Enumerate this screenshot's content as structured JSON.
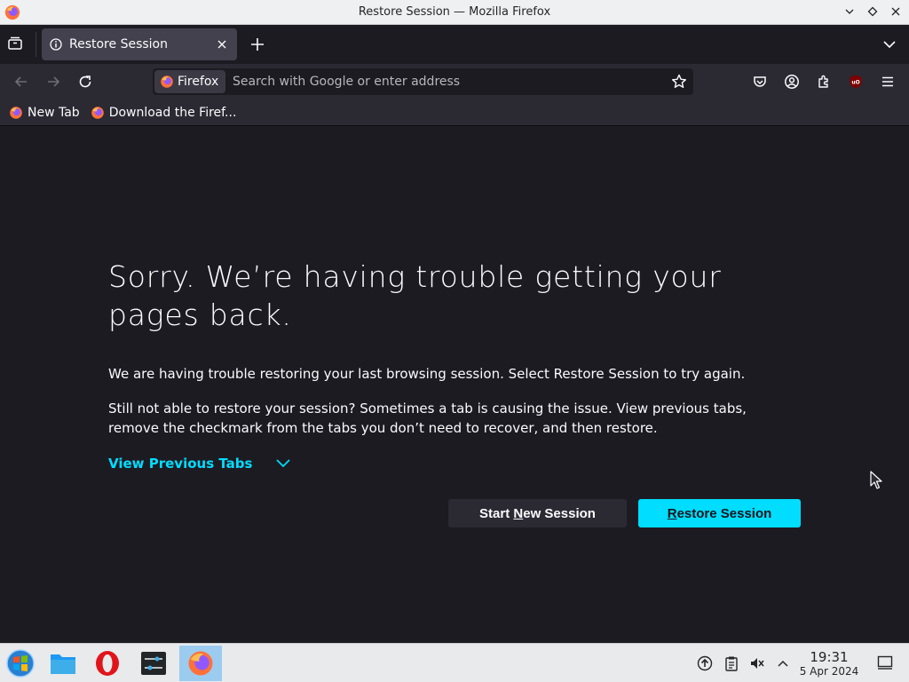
{
  "window": {
    "title": "Restore Session — Mozilla Firefox"
  },
  "tabs": [
    {
      "label": "Restore Session"
    }
  ],
  "urlbar": {
    "identity_label": "Firefox",
    "placeholder": "Search with Google or enter address",
    "value": ""
  },
  "bookmarks": [
    {
      "label": "New Tab"
    },
    {
      "label": "Download the Firef..."
    }
  ],
  "page": {
    "heading": "Sorry. We’re having trouble getting your pages back.",
    "para1": "We are having trouble restoring your last browsing session. Select Restore Session to try again.",
    "para2": "Still not able to restore your session? Sometimes a tab is causing the issue. View previous tabs, remove the checkmark from the tabs you don’t need to recover, and then restore.",
    "view_previous_tabs": "View Previous Tabs",
    "start_new_session": {
      "before": "Start ",
      "accel": "N",
      "after": "ew Session"
    },
    "restore_session": {
      "before": "",
      "accel": "R",
      "after": "estore Session"
    }
  },
  "taskbar": {
    "apps": [
      {
        "name": "start-menu"
      },
      {
        "name": "file-manager"
      },
      {
        "name": "opera"
      },
      {
        "name": "settings"
      },
      {
        "name": "firefox",
        "active": true
      }
    ],
    "time": "19:31",
    "date": "5 Apr 2024"
  },
  "colors": {
    "accent": "#00ddff",
    "background": "#1c1b22",
    "toolbar": "#2b2a33"
  }
}
